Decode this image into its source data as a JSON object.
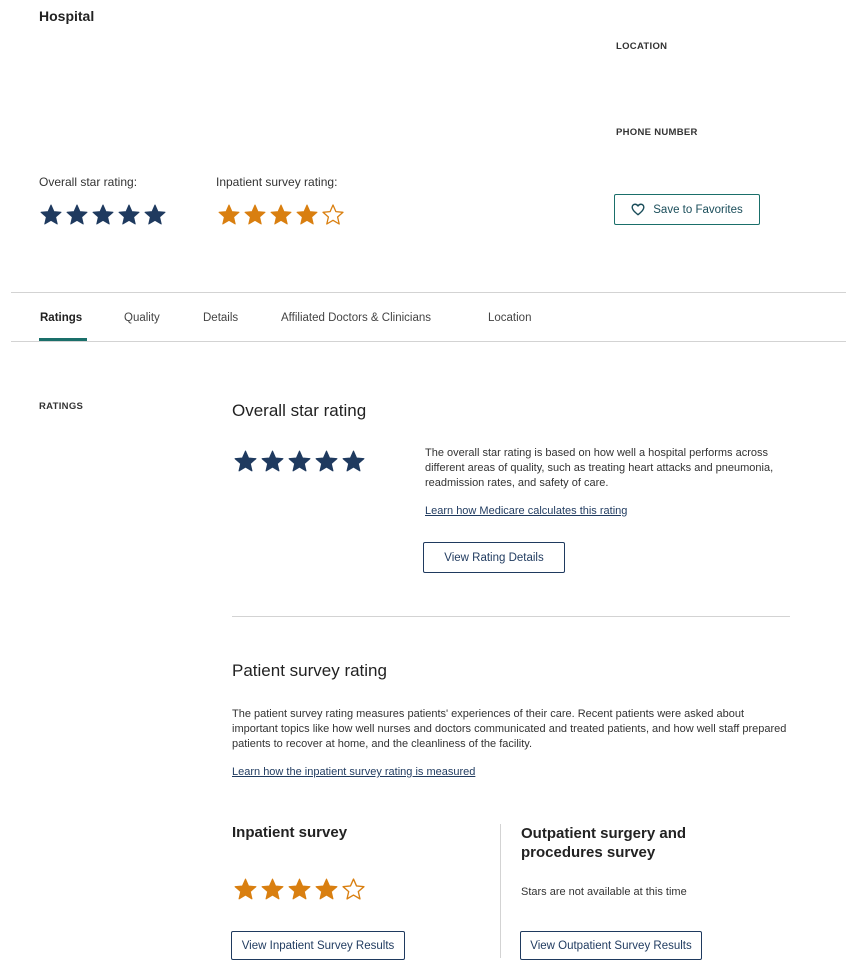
{
  "header": {
    "title": "Hospital",
    "location_label": "LOCATION",
    "phone_label": "PHONE NUMBER",
    "overall_label": "Overall star rating:",
    "overall_stars": 5,
    "inpatient_label": "Inpatient survey rating:",
    "inpatient_stars": 4,
    "favorites_label": "Save to Favorites"
  },
  "tabs": [
    {
      "label": "Ratings",
      "active": true
    },
    {
      "label": "Quality"
    },
    {
      "label": "Details"
    },
    {
      "label": "Affiliated Doctors & Clinicians"
    },
    {
      "label": "Location"
    }
  ],
  "side_label": "RATINGS",
  "overall": {
    "heading": "Overall star rating",
    "stars": 5,
    "description": "The overall star rating is based on how well a hospital performs across different areas of quality, such as treating heart attacks and pneumonia, readmission rates, and safety of care.",
    "link": "Learn how Medicare calculates this rating",
    "button": "View Rating Details"
  },
  "patient_survey": {
    "heading": "Patient survey rating",
    "description": "The patient survey rating measures patients' experiences of their care. Recent patients were asked about important topics like how well nurses and doctors communicated and treated patients, and how well staff prepared patients to recover at home, and the cleanliness of the facility.",
    "link": "Learn how the inpatient survey rating is measured",
    "inpatient": {
      "heading": "Inpatient survey",
      "stars": 4,
      "button": "View Inpatient Survey Results"
    },
    "outpatient": {
      "heading": "Outpatient surgery and procedures survey",
      "note": "Stars are not available at this time",
      "button": "View Outpatient Survey Results"
    }
  },
  "colors": {
    "navy_star": "#1f3a5f",
    "orange_star": "#d97f10",
    "teal": "#1a6f6a"
  }
}
